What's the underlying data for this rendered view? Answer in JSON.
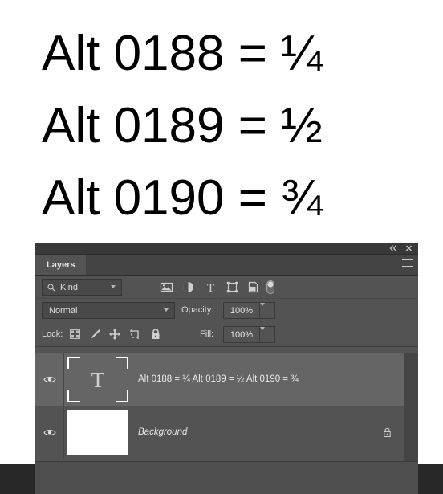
{
  "document": {
    "lines": [
      "Alt 0188 = ¼",
      "Alt 0189 = ½",
      "Alt 0190 = ¾"
    ]
  },
  "panel": {
    "titlebar": {
      "collapse_label": "«",
      "close_label": "✕",
      "collapse_icon": "double-chevron-left-icon",
      "close_icon": "close-icon"
    },
    "tab_label": "Layers",
    "menu_icon": "hamburger-menu-icon",
    "filter_row": {
      "kind_label": "Kind",
      "search_icon": "search-icon",
      "icons": [
        "pixel-layer-filter-icon",
        "adjustment-layer-filter-icon",
        "type-layer-filter-icon",
        "shape-layer-filter-icon",
        "smart-object-filter-icon",
        "filter-toggle-switch"
      ]
    },
    "blend_row": {
      "blend_mode": "Normal",
      "opacity_label": "Opacity:",
      "opacity_value": "100%"
    },
    "lock_row": {
      "lock_label": "Lock:",
      "lock_icons": [
        "lock-transparent-pixels-icon",
        "lock-image-pixels-icon",
        "lock-position-icon",
        "lock-artboard-nesting-icon",
        "lock-all-icon"
      ],
      "fill_label": "Fill:",
      "fill_value": "100%"
    },
    "layers": [
      {
        "name": "Alt 0188 = ¼ Alt 0189 = ½ Alt 0190 = ¾",
        "type": "type",
        "thumb_glyph": "T",
        "visible": true,
        "selected": true,
        "locked": false,
        "italic": false
      },
      {
        "name": "Background",
        "type": "image",
        "thumb_glyph": "",
        "visible": true,
        "selected": false,
        "locked": true,
        "italic": true
      }
    ]
  },
  "colors": {
    "panel_bg": "#535353",
    "panel_titlebar": "#393939",
    "panel_tabstrip": "#444444",
    "field_bg": "#494949",
    "selected_layer": "#656565",
    "text": "#d4d4d4",
    "workspace_dark": "#282828",
    "canvas_white": "#ffffff"
  }
}
